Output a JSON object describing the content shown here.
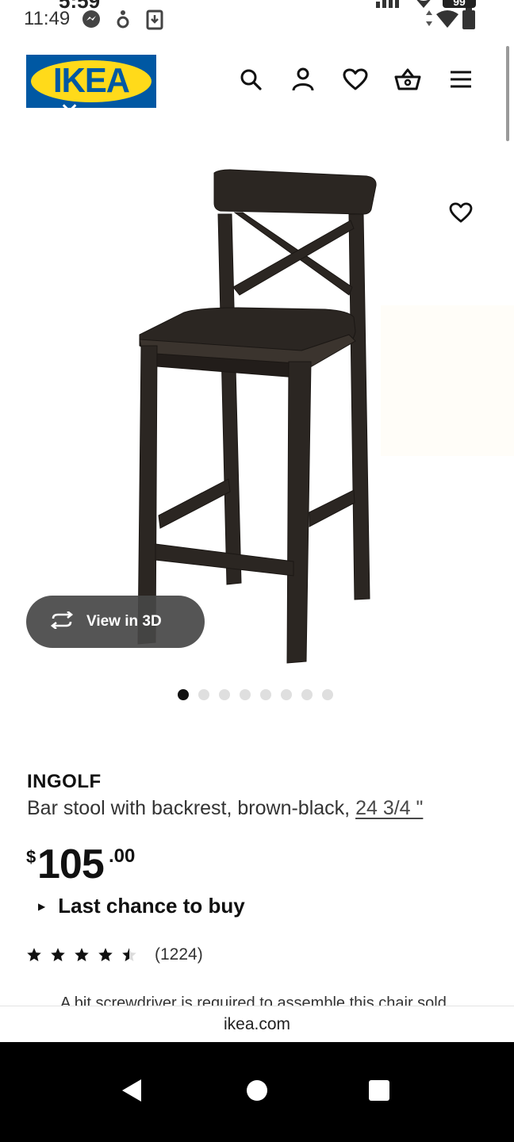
{
  "status_bar": {
    "ghost_time": "5:59",
    "time": "11:49",
    "battery": "99",
    "icons": [
      "messenger-icon",
      "accessibility-icon",
      "download-icon",
      "signal-icon",
      "wifi-icon",
      "battery-icon"
    ]
  },
  "header": {
    "logo_text": "IKEA",
    "logo_close": "✕",
    "icons": [
      "search-icon",
      "account-icon",
      "favorites-icon",
      "basket-icon",
      "menu-icon"
    ]
  },
  "product_image": {
    "alt_subject": "INGOLF",
    "view_3d_label": "View in 3D",
    "carousel_count": 8,
    "carousel_active": 1
  },
  "product": {
    "name": "INGOLF",
    "description": "Bar stool with backrest, brown-black,",
    "size": "24 3/4 \"",
    "price_currency": "$",
    "price_integer": "105",
    "price_decimal": ".00",
    "availability": "Last chance to buy",
    "rating_stars": 4.5,
    "rating_count": "(1224)",
    "notice": "A bit screwdriver is required to assemble this chair sold"
  },
  "browser": {
    "url": "ikea.com"
  },
  "colors": {
    "brand_blue": "#0058a3",
    "brand_yellow": "#ffda1a",
    "text": "#111111",
    "chair": "#2b2622"
  }
}
